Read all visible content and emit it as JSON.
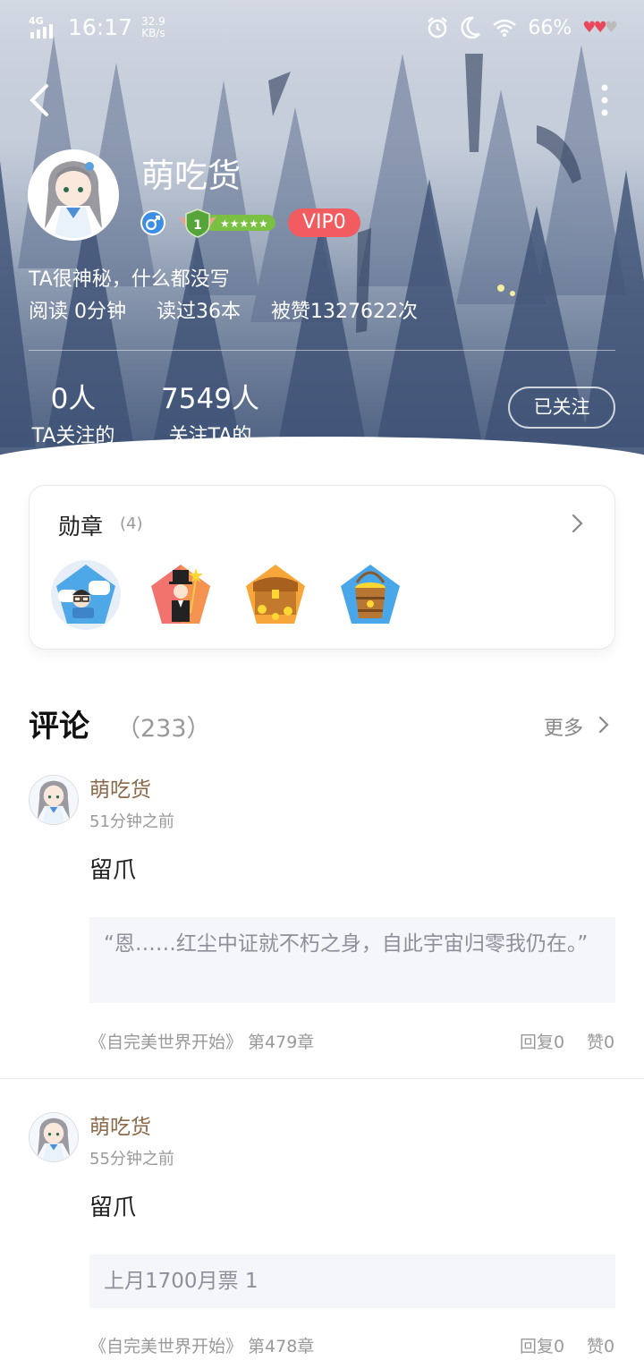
{
  "status_bar": {
    "network": "4G",
    "time": "16:17",
    "speed_value": "32.9",
    "speed_unit": "KB/s",
    "battery": "66%",
    "icons": [
      "signal-icon",
      "alarm-icon",
      "moon-icon",
      "wifi-icon",
      "hearts-icon"
    ]
  },
  "profile": {
    "username": "萌吃货",
    "gender_icon": "male-icon",
    "level": "1",
    "vip": "VIP0",
    "bio": "TA很神秘，什么都没写",
    "read_time": "阅读 0分钟",
    "books_read": "读过36本",
    "likes": "被赞1327622次",
    "following_count": "0人",
    "following_label": "TA关注的",
    "followers_count": "7549人",
    "followers_label": "关注TA的",
    "follow_button": "已关注"
  },
  "medals": {
    "title": "勋章",
    "count": "(4)",
    "items": [
      "chat-medal-icon",
      "tycoon-medal-icon",
      "treasure-chest-medal-icon",
      "gold-bucket-medal-icon"
    ]
  },
  "comments_section": {
    "title": "评论",
    "count": "（233）",
    "more": "更多",
    "items": [
      {
        "author": "萌吃货",
        "time": "51分钟之前",
        "text": "留爪",
        "quote": "“恩……红尘中证就不朽之身，自此宇宙归零我仍在。”",
        "book": "《自完美世界开始》 第479章",
        "reply": "回复0",
        "like": "赞0"
      },
      {
        "author": "萌吃货",
        "time": "55分钟之前",
        "text": "留爪",
        "quote": "上月1700月票 1",
        "book": "《自完美世界开始》 第478章",
        "reply": "回复0",
        "like": "赞0"
      }
    ]
  }
}
